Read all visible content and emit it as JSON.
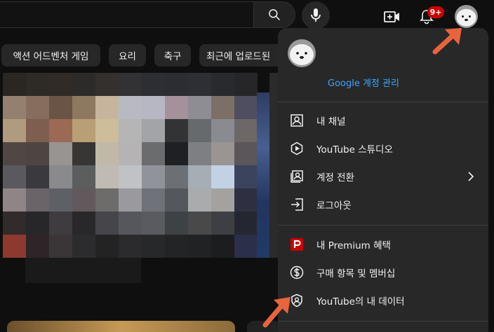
{
  "topbar": {
    "icons": [
      "search-icon",
      "mic-icon",
      "create-video-icon",
      "bell-icon"
    ],
    "notification_badge": "9+",
    "badge_color": "#cc0000"
  },
  "chips": [
    {
      "label": "액션 어드벤처 게임"
    },
    {
      "label": "요리"
    },
    {
      "label": "축구"
    },
    {
      "label": "최근에 업로드된"
    }
  ],
  "menu": {
    "manage_account": "Google 계정 관리",
    "section1": [
      {
        "label": "내 채널",
        "icon": "person-box-icon"
      },
      {
        "label": "YouTube 스튜디오",
        "icon": "studio-icon"
      },
      {
        "label": "계정 전환",
        "icon": "switch-account-icon",
        "has_submenu": true
      },
      {
        "label": "로그아웃",
        "icon": "sign-out-icon"
      }
    ],
    "section2": [
      {
        "label": "내 Premium 혜택",
        "icon": "premium-icon"
      },
      {
        "label": "구매 항목 및 멤버십",
        "icon": "dollar-icon"
      },
      {
        "label": "YouTube의 내 데이터",
        "icon": "shield-person-icon"
      }
    ],
    "link_color": "#3ea6ff",
    "premium_color": "#cc0000"
  },
  "annotations": {
    "arrow_color": "#e8643c"
  }
}
